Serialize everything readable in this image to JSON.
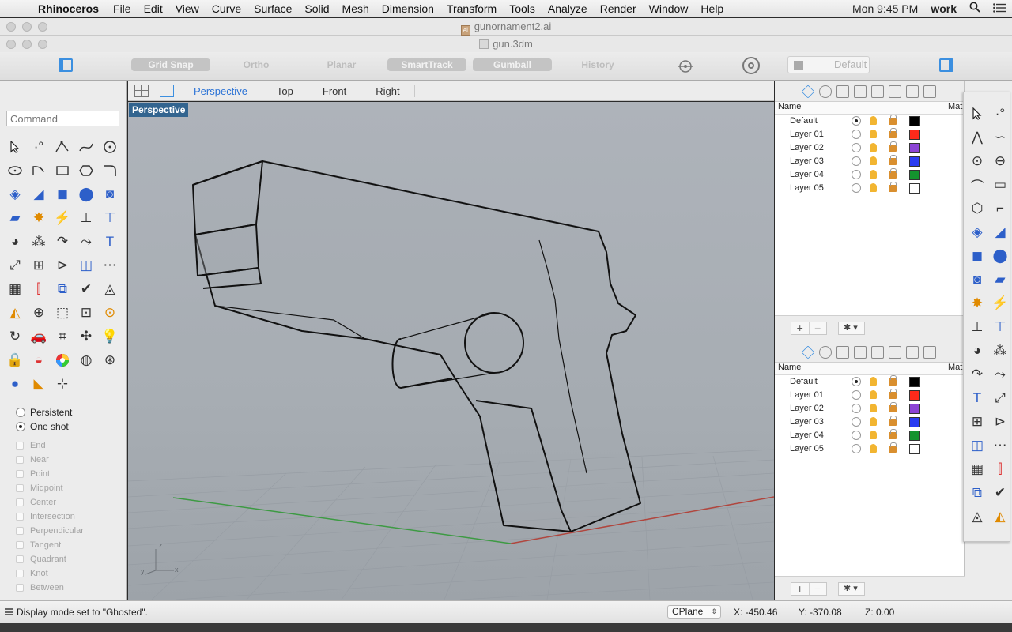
{
  "menubar": {
    "app_name": "Rhinoceros",
    "items": [
      "File",
      "Edit",
      "View",
      "Curve",
      "Surface",
      "Solid",
      "Mesh",
      "Dimension",
      "Transform",
      "Tools",
      "Analyze",
      "Render",
      "Window",
      "Help"
    ],
    "clock": "Mon 9:45 PM",
    "user": "work"
  },
  "windows": {
    "background_title": "gunornament2.ai",
    "active_title": "gun.3dm"
  },
  "toolbar": {
    "grid_snap": "Grid Snap",
    "ortho": "Ortho",
    "planar": "Planar",
    "smarttrack": "SmartTrack",
    "gumball": "Gumball",
    "history": "History",
    "layer_value": "Default"
  },
  "command": {
    "placeholder": "Command"
  },
  "osnap": {
    "persistent": "Persistent",
    "one_shot": "One shot",
    "items": [
      "End",
      "Near",
      "Point",
      "Midpoint",
      "Center",
      "Intersection",
      "Perpendicular",
      "Tangent",
      "Quadrant",
      "Knot",
      "Between"
    ]
  },
  "viewport_tabs": [
    "Perspective",
    "Top",
    "Front",
    "Right"
  ],
  "viewport": {
    "label": "Perspective",
    "axis_z": "z",
    "axis_x": "x",
    "axis_y": "y"
  },
  "layers": {
    "col_name": "Name",
    "col_material": "Mat",
    "rows": [
      {
        "name": "Default",
        "color": "#000000",
        "current": true
      },
      {
        "name": "Layer 01",
        "color": "#ff2a1a",
        "current": false
      },
      {
        "name": "Layer 02",
        "color": "#8c44d6",
        "current": false
      },
      {
        "name": "Layer 03",
        "color": "#2a3cf2",
        "current": false
      },
      {
        "name": "Layer 04",
        "color": "#14932e",
        "current": false
      },
      {
        "name": "Layer 05",
        "color": "#ffffff",
        "current": false
      }
    ],
    "plus": "+",
    "minus": "−"
  },
  "status": {
    "message": "Display mode set to \"Ghosted\".",
    "cplane": "CPlane",
    "x": "X: -450.46",
    "y": "Y: -370.08",
    "z": "Z: 0.00"
  }
}
